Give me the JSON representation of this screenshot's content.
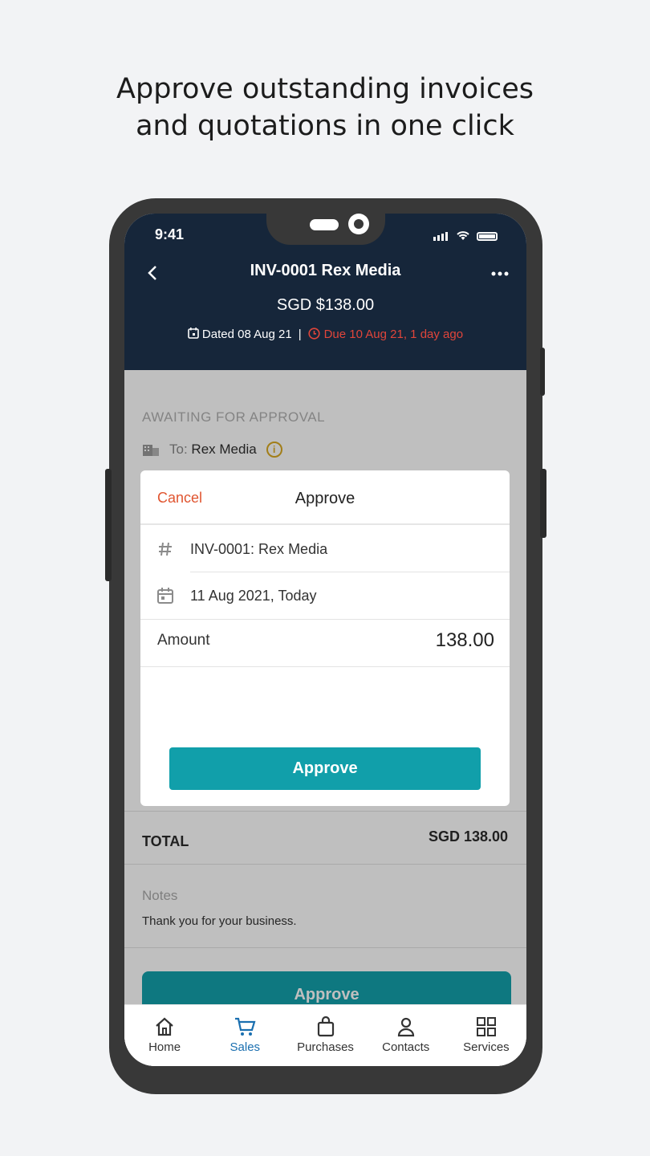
{
  "headline": {
    "line1": "Approve outstanding invoices",
    "line2": "and quotations in one click"
  },
  "status_bar": {
    "time": "9:41"
  },
  "header": {
    "title": "INV-0001 Rex Media",
    "amount": "SGD $138.00",
    "dated": "Dated 08 Aug 21",
    "separator": "|",
    "due": "Due 10 Aug 21, 1 day ago"
  },
  "details": {
    "status_label": "AWAITING FOR APPROVAL",
    "to_prefix": "To:",
    "to_name": "Rex Media"
  },
  "modal": {
    "cancel_label": "Cancel",
    "title": "Approve",
    "reference": "INV-0001: Rex Media",
    "date": "11 Aug 2021, Today",
    "amount_label": "Amount",
    "amount_value": "138.00",
    "approve_label": "Approve"
  },
  "summary": {
    "total_label": "TOTAL",
    "total_value": "SGD 138.00"
  },
  "notes": {
    "label": "Notes",
    "text": "Thank you for your business."
  },
  "bottom_button": {
    "label": "Approve"
  },
  "tabbar": {
    "items": [
      {
        "label": "Home",
        "icon": "home-icon"
      },
      {
        "label": "Sales",
        "icon": "cart-icon",
        "active": true
      },
      {
        "label": "Purchases",
        "icon": "bag-icon"
      },
      {
        "label": "Contacts",
        "icon": "person-icon"
      },
      {
        "label": "Services",
        "icon": "grid-icon"
      }
    ]
  },
  "colors": {
    "header_bg": "#16263a",
    "accent": "#119faa",
    "danger": "#e0453a",
    "cancel": "#e05530",
    "active_tab": "#1a6fb0"
  }
}
